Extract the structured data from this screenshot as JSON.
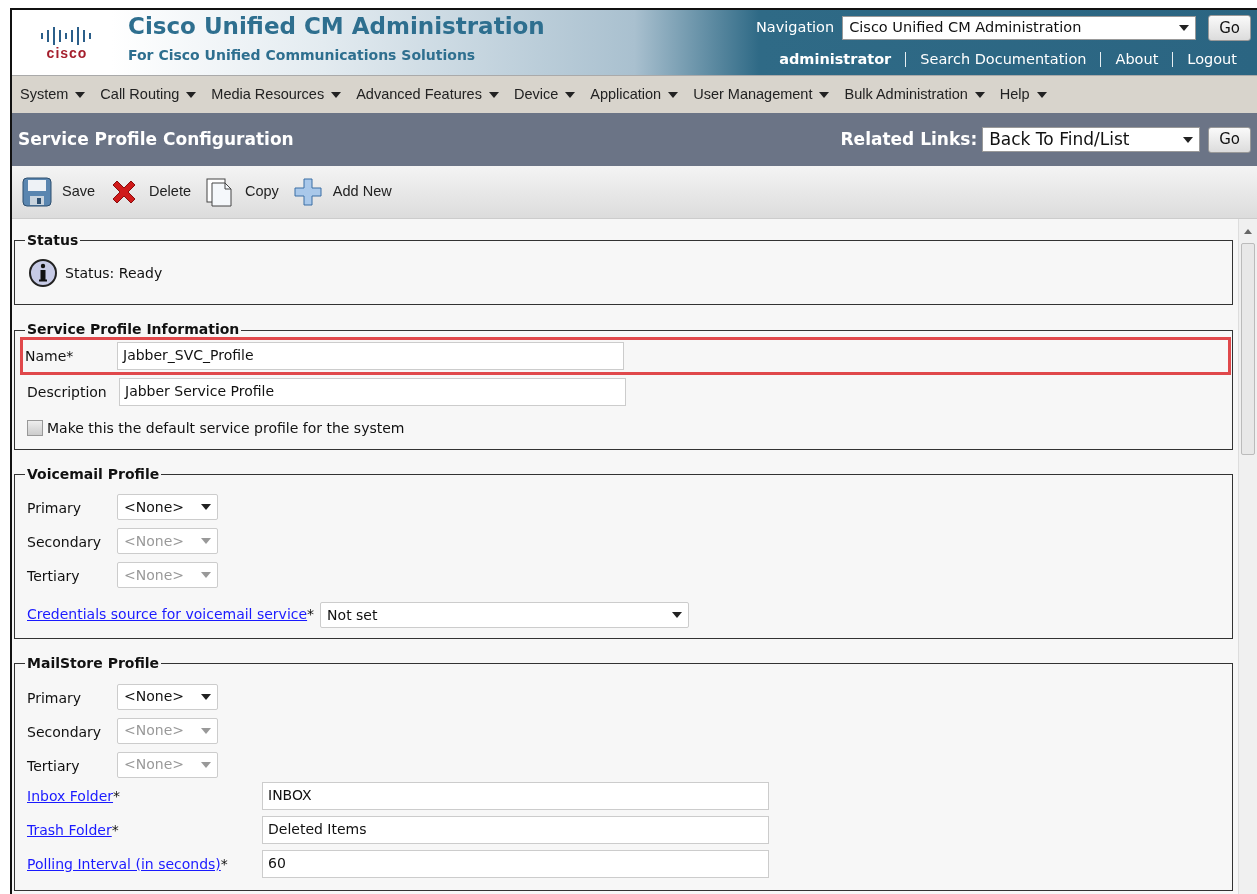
{
  "header": {
    "logo_text": "cisco",
    "title": "Cisco Unified CM Administration",
    "subtitle": "For Cisco Unified Communications Solutions",
    "navigation_label": "Navigation",
    "navigation_value": "Cisco Unified CM Administration",
    "navigation_button": "Go",
    "user": "administrator",
    "links": [
      "Search Documentation",
      "About",
      "Logout"
    ]
  },
  "menu": [
    "System",
    "Call Routing",
    "Media Resources",
    "Advanced Features",
    "Device",
    "Application",
    "User Management",
    "Bulk Administration",
    "Help"
  ],
  "page_title": "Service Profile Configuration",
  "related_links": {
    "label": "Related Links:",
    "value": "Back To Find/List",
    "button": "Go"
  },
  "toolbar": [
    {
      "label": "Save",
      "kind": "save"
    },
    {
      "label": "Delete",
      "kind": "delete"
    },
    {
      "label": "Copy",
      "kind": "copy"
    },
    {
      "label": "Add New",
      "kind": "add"
    }
  ],
  "sections": [
    {
      "title": "Status",
      "kind": "status",
      "rows": [
        {
          "kind": "status",
          "text": "Status: Ready"
        }
      ]
    },
    {
      "title": "Service Profile Information",
      "kind": "info",
      "rows": [
        {
          "kind": "text",
          "label": "Name",
          "mark": "*",
          "value": "Jabber_SVC_Profile",
          "link": false,
          "highlighted": true
        },
        {
          "kind": "text",
          "label": "Description",
          "value": "Jabber Service Profile",
          "link": false,
          "highlighted": false
        },
        {
          "kind": "checkbox",
          "label": "Make this the default service profile for the system",
          "checked": false
        }
      ]
    },
    {
      "title": "Voicemail Profile",
      "kind": "servers",
      "rows": [
        {
          "kind": "select",
          "label": "Primary",
          "value": "<None>",
          "disabled": false
        },
        {
          "kind": "select",
          "label": "Secondary",
          "value": "<None>",
          "disabled": true
        },
        {
          "kind": "select",
          "label": "Tertiary",
          "value": "<None>",
          "disabled": true
        },
        {
          "kind": "combo",
          "label": "Credentials source for voicemail service",
          "mark": "*",
          "value": "Not set",
          "link": true
        }
      ]
    },
    {
      "title": "MailStore Profile",
      "kind": "servers",
      "rows": [
        {
          "kind": "select",
          "label": "Primary",
          "value": "<None>",
          "disabled": false
        },
        {
          "kind": "select",
          "label": "Secondary",
          "value": "<None>",
          "disabled": true
        },
        {
          "kind": "select",
          "label": "Tertiary",
          "value": "<None>",
          "disabled": true
        },
        {
          "kind": "text",
          "label": "Inbox Folder",
          "mark": "*",
          "value": "INBOX",
          "link": true,
          "highlighted": false
        },
        {
          "kind": "text",
          "label": "Trash Folder",
          "mark": "*",
          "value": "Deleted Items",
          "link": true,
          "highlighted": false
        },
        {
          "kind": "text",
          "label": "Polling Interval (in seconds)",
          "mark": "*",
          "value": "60",
          "link": true,
          "highlighted": false
        }
      ]
    }
  ]
}
